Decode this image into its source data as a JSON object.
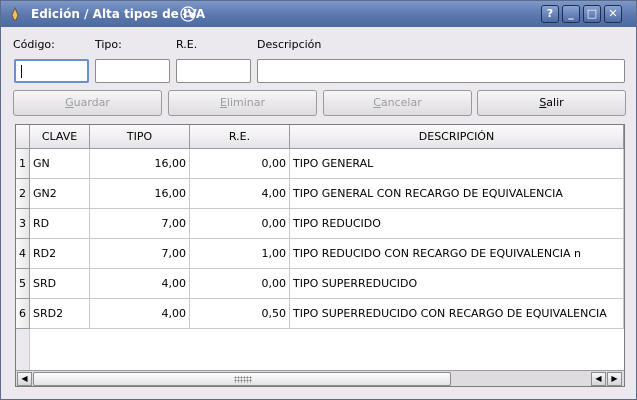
{
  "window": {
    "title": "Edición / Alta tipos de IVA",
    "controls": {
      "help": "?",
      "minimize": "_",
      "maximize": "□",
      "close": "✕"
    }
  },
  "form": {
    "labels": {
      "codigo": "Código:",
      "tipo": "Tipo:",
      "re": "R.E.",
      "descripcion": "Descripción"
    },
    "values": {
      "codigo": "",
      "tipo": "",
      "re": "",
      "descripcion": ""
    }
  },
  "buttons": {
    "guardar": {
      "mnemonic": "G",
      "rest": "uardar"
    },
    "eliminar": {
      "mnemonic": "E",
      "rest": "liminar"
    },
    "cancelar": {
      "mnemonic": "C",
      "rest": "ancelar"
    },
    "salir": {
      "mnemonic": "S",
      "rest": "alir"
    }
  },
  "table": {
    "columns": [
      "CLAVE",
      "TIPO",
      "R.E.",
      "DESCRIPCIÓN"
    ],
    "rows": [
      {
        "n": "1",
        "clave": "GN",
        "tipo": "16,00",
        "re": "0,00",
        "desc": "TIPO GENERAL"
      },
      {
        "n": "2",
        "clave": "GN2",
        "tipo": "16,00",
        "re": "4,00",
        "desc": "TIPO GENERAL CON RECARGO DE EQUIVALENCIA"
      },
      {
        "n": "3",
        "clave": "RD",
        "tipo": "7,00",
        "re": "0,00",
        "desc": "TIPO REDUCIDO"
      },
      {
        "n": "4",
        "clave": "RD2",
        "tipo": "7,00",
        "re": "1,00",
        "desc": "TIPO REDUCIDO CON RECARGO DE EQUIVALENCIA n"
      },
      {
        "n": "5",
        "clave": "SRD",
        "tipo": "4,00",
        "re": "0,00",
        "desc": "TIPO SUPERREDUCIDO"
      },
      {
        "n": "6",
        "clave": "SRD2",
        "tipo": "4,00",
        "re": "0,50",
        "desc": "TIPO SUPERREDUCIDO CON RECARGO DE EQUIVALENCIA"
      }
    ]
  },
  "scrollbar": {
    "left_arrow": "◀",
    "right_arrow": "▶"
  },
  "colors": {
    "titlebar": "#5a76ad",
    "window_bg": "#ebe9ed",
    "focus": "#6b8fd0"
  },
  "icons": [
    "app-icon",
    "kde-swirl-icon",
    "help-icon",
    "minimize-icon",
    "maximize-icon",
    "close-icon",
    "scroll-grip-icon"
  ]
}
